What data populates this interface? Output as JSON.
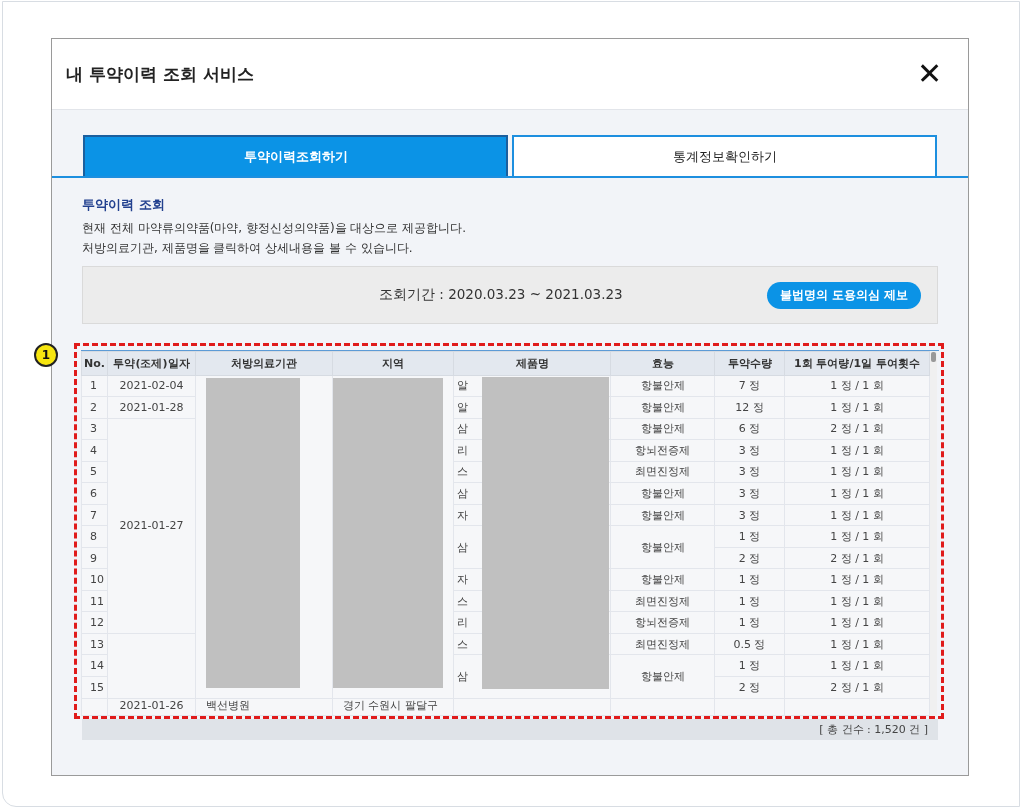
{
  "dialog": {
    "title": "내 투약이력 조회 서비스",
    "close": "✕"
  },
  "tabs": [
    {
      "label": "투약이력조회하기",
      "selected": true
    },
    {
      "label": "통계정보확인하기",
      "selected": false
    }
  ],
  "section": {
    "heading": "투약이력 조회",
    "lines": [
      "현재 전체 마약류의약품(마약, 향정신성의약품)을 대상으로 제공합니다.",
      "처방의료기관, 제품명을 클릭하여 상세내용을 볼 수 있습니다."
    ]
  },
  "period": {
    "text": "조회기간 : 2020.03.23 ~ 2021.03.23",
    "button": "불법명의 도용의심 제보"
  },
  "annotation": {
    "badge": "1"
  },
  "table": {
    "columns": [
      "No.",
      "투약(조제)일자",
      "처방의료기관",
      "지역",
      "제품명",
      "효능",
      "투약수량",
      "1회 투여량/1일 투여횟수"
    ],
    "date_groups": [
      {
        "date": "2021-02-04",
        "items": [
          {
            "no": "1",
            "product": "알",
            "efficacy": "항불안제",
            "quantity": "7 정",
            "dose": "1 정 / 1 회"
          }
        ]
      },
      {
        "date": "2021-01-28",
        "items": [
          {
            "no": "2",
            "product": "알",
            "efficacy": "항불안제",
            "quantity": "12 정",
            "dose": "1 정 / 1 회"
          }
        ]
      },
      {
        "date": "2021-01-27",
        "items": [
          {
            "no": "3",
            "product": "삼",
            "efficacy": "항불안제",
            "quantity": "6 정",
            "dose": "2 정 / 1 회"
          },
          {
            "no": "4",
            "product": "리",
            "efficacy": "항뇌전증제",
            "quantity": "3 정",
            "dose": "1 정 / 1 회"
          },
          {
            "no": "5",
            "product": "스",
            "efficacy": "최면진정제",
            "quantity": "3 정",
            "dose": "1 정 / 1 회"
          },
          {
            "no": "6",
            "product": "삼",
            "efficacy": "항불안제",
            "quantity": "3 정",
            "dose": "1 정 / 1 회"
          },
          {
            "no": "7",
            "product": "자",
            "efficacy": "항불안제",
            "quantity": "3 정",
            "dose": "1 정 / 1 회"
          },
          {
            "no": "8",
            "product": "삼",
            "efficacy": "항불안제",
            "quantity": "1 정",
            "dose": "1 정 / 1 회"
          },
          {
            "no": "9",
            "quantity": "2 정",
            "dose": "2 정 / 1 회"
          },
          {
            "no": "10",
            "product": "자",
            "efficacy": "항불안제",
            "quantity": "1 정",
            "dose": "1 정 / 1 회"
          },
          {
            "no": "11",
            "product": "스",
            "efficacy": "최면진정제",
            "quantity": "1 정",
            "dose": "1 정 / 1 회"
          },
          {
            "no": "12",
            "product": "리",
            "efficacy": "항뇌전증제",
            "quantity": "1 정",
            "dose": "1 정 / 1 회"
          }
        ]
      },
      {
        "items": [
          {
            "no": "13",
            "product": "스",
            "efficacy": "최면진정제",
            "quantity": "0.5 정",
            "dose": "1 정 / 1 회"
          },
          {
            "no": "14",
            "product": "삼",
            "efficacy": "항불안제",
            "quantity": "1 정",
            "dose": "1 정 / 1 회"
          },
          {
            "no": "15",
            "quantity": "2 정",
            "dose": "2 정 / 1 회"
          }
        ]
      }
    ],
    "cut_row": {
      "date": "2021-01-26",
      "institution": "백선병원",
      "region": "경기 수원시 팔달구"
    },
    "total": "[ 총 건수 : 1,520 건 ]"
  }
}
